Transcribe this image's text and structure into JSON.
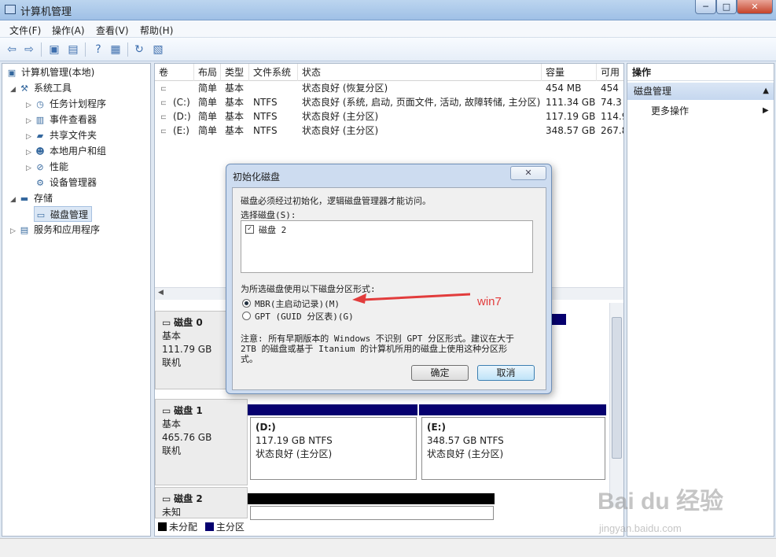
{
  "window": {
    "title": "计算机管理",
    "min": "─",
    "max": "□",
    "close": "✕"
  },
  "menu": [
    "文件(F)",
    "操作(A)",
    "查看(V)",
    "帮助(H)"
  ],
  "tree": {
    "root": "计算机管理(本地)",
    "system_tools": "系统工具",
    "task_scheduler": "任务计划程序",
    "event_viewer": "事件查看器",
    "shared_folders": "共享文件夹",
    "local_users": "本地用户和组",
    "performance": "性能",
    "device_manager": "设备管理器",
    "storage": "存储",
    "disk_management": "磁盘管理",
    "services": "服务和应用程序"
  },
  "volumes": {
    "headers": [
      "卷",
      "布局",
      "类型",
      "文件系统",
      "状态",
      "容量",
      "可用"
    ],
    "rows": [
      [
        "",
        "简单",
        "基本",
        "",
        "状态良好 (恢复分区)",
        "454 MB",
        "454"
      ],
      [
        "(C:)",
        "简单",
        "基本",
        "NTFS",
        "状态良好 (系统, 启动, 页面文件, 活动, 故障转储, 主分区)",
        "111.34 GB",
        "74.3"
      ],
      [
        "(D:)",
        "简单",
        "基本",
        "NTFS",
        "状态良好 (主分区)",
        "117.19 GB",
        "114.9"
      ],
      [
        "(E:)",
        "简单",
        "基本",
        "NTFS",
        "状态良好 (主分区)",
        "348.57 GB",
        "267.8"
      ]
    ]
  },
  "disks": {
    "disk0": {
      "name": "磁盘 0",
      "type": "基本",
      "size": "111.79 GB",
      "status": "联机"
    },
    "disk1": {
      "name": "磁盘 1",
      "type": "基本",
      "size": "465.76 GB",
      "status": "联机",
      "parts": [
        {
          "name": "(D:)",
          "size": "117.19 GB NTFS",
          "status": "状态良好 (主分区)"
        },
        {
          "name": "(E:)",
          "size": "348.57 GB NTFS",
          "status": "状态良好 (主分区)"
        }
      ]
    },
    "disk2": {
      "name": "磁盘 2",
      "type": "未知"
    }
  },
  "legend": {
    "unallocated": "未分配",
    "primary": "主分区"
  },
  "actions": {
    "title": "操作",
    "group": "磁盘管理",
    "more": "更多操作"
  },
  "dialog": {
    "title": "初始化磁盘",
    "message": "磁盘必须经过初始化，逻辑磁盘管理器才能访问。",
    "select_label": "选择磁盘(S):",
    "disk_item": "磁盘 2",
    "style_label": "为所选磁盘使用以下磁盘分区形式:",
    "mbr": "MBR(主启动记录)(M)",
    "gpt": "GPT (GUID 分区表)(G)",
    "note_line1": "注意: 所有早期版本的 Windows 不识别 GPT 分区形式。建议在大于",
    "note_line2": "2TB 的磁盘或基于 Itanium 的计算机所用的磁盘上使用这种分区形",
    "note_line3": "式。",
    "ok": "确定",
    "cancel": "取消",
    "close": "✕"
  },
  "annotation": "win7",
  "watermark": {
    "main": "Bai du 经验",
    "sub": "jingyan.baidu.com"
  },
  "colors": {
    "primary_partition": "#06006f",
    "unallocated": "#000000",
    "annotation": "#e23c3c"
  }
}
